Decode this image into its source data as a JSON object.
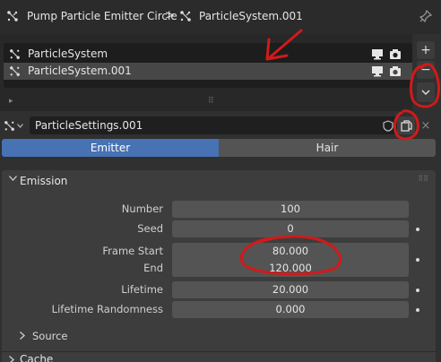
{
  "breadcrumb": {
    "object_name": "Pump Particle Emitter Circle",
    "separator": ">",
    "system_name": "ParticleSystem.001"
  },
  "particle_systems": {
    "items": [
      {
        "label": "ParticleSystem",
        "selected": false
      },
      {
        "label": "ParticleSystem.001",
        "selected": true
      }
    ],
    "buttons": {
      "add": "+",
      "remove": "−"
    }
  },
  "settings": {
    "name": "ParticleSettings.001",
    "unlink": "×"
  },
  "type_tabs": {
    "emitter": "Emitter",
    "hair": "Hair"
  },
  "emission": {
    "title": "Emission",
    "number": {
      "label": "Number",
      "value": "100"
    },
    "seed": {
      "label": "Seed",
      "value": "0"
    },
    "frame_start": {
      "label": "Frame Start",
      "value": "80.000"
    },
    "frame_end": {
      "label": "End",
      "value": "120.000"
    },
    "lifetime": {
      "label": "Lifetime",
      "value": "20.000"
    },
    "lifetime_randomness": {
      "label": "Lifetime Randomness",
      "value": "0.000"
    }
  },
  "subpanels": {
    "source": "Source",
    "cache": "Cache"
  },
  "colors": {
    "accent": "#4772b3",
    "annotation": "#d11a1a"
  }
}
